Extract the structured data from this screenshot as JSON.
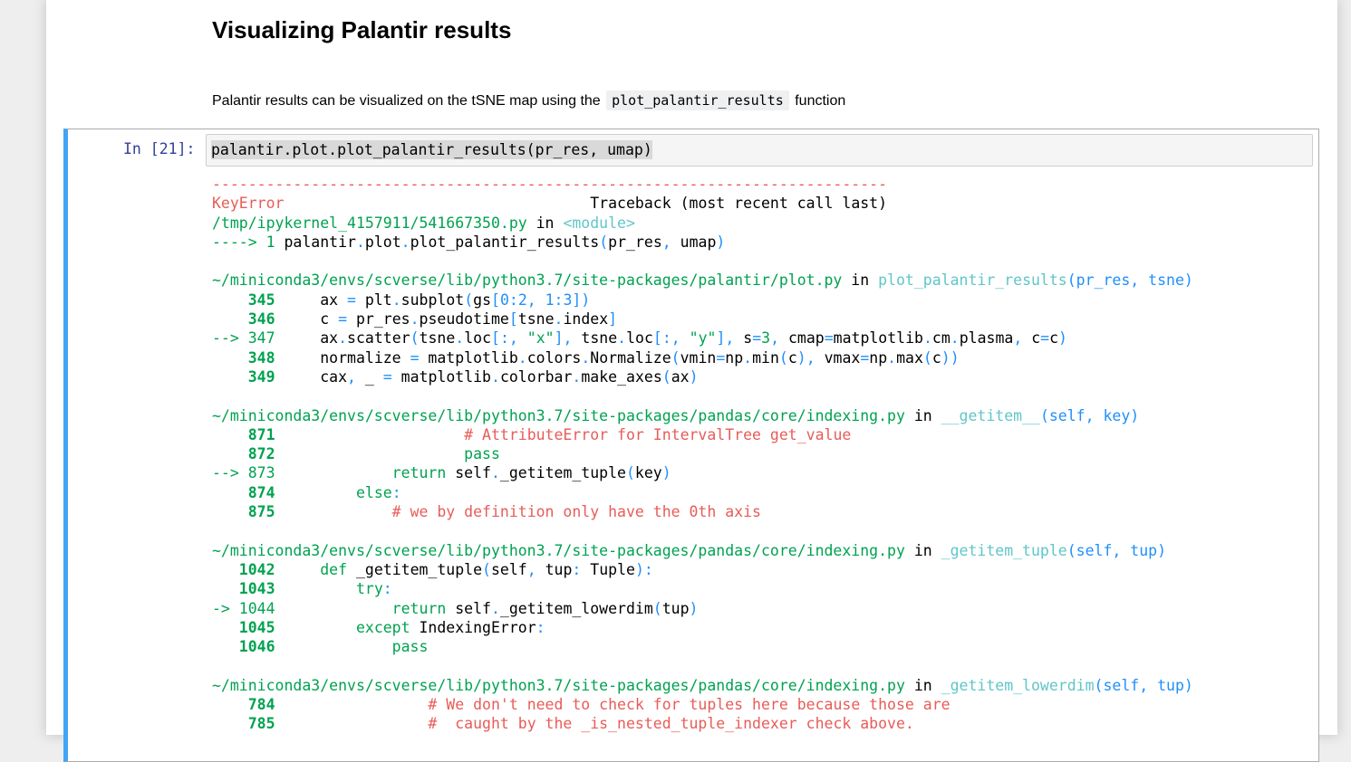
{
  "markdown": {
    "title": "Visualizing Palantir results",
    "para_before": "Palantir results can be visualized on the tSNE map using the ",
    "para_code": "plot_palantir_results",
    "para_after": " function"
  },
  "cell": {
    "prompt": "In [21]:",
    "input": "palantir.plot.plot_palantir_results(pr_res, umap)",
    "traceback": [
      [
        [
          "r",
          "---------------------------------------------------------------------------"
        ]
      ],
      [
        [
          "r",
          "KeyError"
        ],
        [
          "k",
          "                                  Traceback (most recent call last)"
        ]
      ],
      [
        [
          "g",
          "/tmp/ipykernel_4157911/541667350.py"
        ],
        [
          "k",
          " in "
        ],
        [
          "c",
          "<module>"
        ]
      ],
      [
        [
          "g",
          "----> 1 "
        ],
        [
          "k",
          "palantir"
        ],
        [
          "b",
          "."
        ],
        [
          "k",
          "plot"
        ],
        [
          "b",
          "."
        ],
        [
          "k",
          "plot_palantir_results"
        ],
        [
          "b",
          "("
        ],
        [
          "k",
          "pr_res"
        ],
        [
          "b",
          ", "
        ],
        [
          "k",
          "umap"
        ],
        [
          "b",
          ")"
        ]
      ],
      [],
      [
        [
          "g",
          "~/miniconda3/envs/scverse/lib/python3.7/site-packages/palantir/plot.py"
        ],
        [
          "k",
          " in "
        ],
        [
          "c",
          "plot_palantir_results"
        ],
        [
          "b",
          "(pr_res, tsne)"
        ]
      ],
      [
        [
          "gb",
          "    345"
        ],
        [
          "k",
          "     ax "
        ],
        [
          "b",
          "="
        ],
        [
          "k",
          " plt"
        ],
        [
          "b",
          "."
        ],
        [
          "k",
          "subplot"
        ],
        [
          "b",
          "("
        ],
        [
          "k",
          "gs"
        ],
        [
          "b",
          "[0:2, 1:3])"
        ]
      ],
      [
        [
          "gb",
          "    346"
        ],
        [
          "k",
          "     c "
        ],
        [
          "b",
          "="
        ],
        [
          "k",
          " pr_res"
        ],
        [
          "b",
          "."
        ],
        [
          "k",
          "pseudotime"
        ],
        [
          "b",
          "["
        ],
        [
          "k",
          "tsne"
        ],
        [
          "b",
          "."
        ],
        [
          "k",
          "index"
        ],
        [
          "b",
          "]"
        ]
      ],
      [
        [
          "g",
          "--> 347"
        ],
        [
          "k",
          "     ax"
        ],
        [
          "b",
          "."
        ],
        [
          "k",
          "scatter"
        ],
        [
          "b",
          "("
        ],
        [
          "k",
          "tsne"
        ],
        [
          "b",
          "."
        ],
        [
          "k",
          "loc"
        ],
        [
          "b",
          "[:, "
        ],
        [
          "g",
          "\"x\""
        ],
        [
          "b",
          "], "
        ],
        [
          "k",
          "tsne"
        ],
        [
          "b",
          "."
        ],
        [
          "k",
          "loc"
        ],
        [
          "b",
          "[:, "
        ],
        [
          "g",
          "\"y\""
        ],
        [
          "b",
          "], "
        ],
        [
          "k",
          "s"
        ],
        [
          "b",
          "="
        ],
        [
          "g",
          "3"
        ],
        [
          "b",
          ", "
        ],
        [
          "k",
          "cmap"
        ],
        [
          "b",
          "="
        ],
        [
          "k",
          "matplotlib"
        ],
        [
          "b",
          "."
        ],
        [
          "k",
          "cm"
        ],
        [
          "b",
          "."
        ],
        [
          "k",
          "plasma"
        ],
        [
          "b",
          ", "
        ],
        [
          "k",
          "c"
        ],
        [
          "b",
          "="
        ],
        [
          "k",
          "c"
        ],
        [
          "b",
          ")"
        ]
      ],
      [
        [
          "gb",
          "    348"
        ],
        [
          "k",
          "     normalize "
        ],
        [
          "b",
          "="
        ],
        [
          "k",
          " matplotlib"
        ],
        [
          "b",
          "."
        ],
        [
          "k",
          "colors"
        ],
        [
          "b",
          "."
        ],
        [
          "k",
          "Normalize"
        ],
        [
          "b",
          "("
        ],
        [
          "k",
          "vmin"
        ],
        [
          "b",
          "="
        ],
        [
          "k",
          "np"
        ],
        [
          "b",
          "."
        ],
        [
          "k",
          "min"
        ],
        [
          "b",
          "("
        ],
        [
          "k",
          "c"
        ],
        [
          "b",
          "), "
        ],
        [
          "k",
          "vmax"
        ],
        [
          "b",
          "="
        ],
        [
          "k",
          "np"
        ],
        [
          "b",
          "."
        ],
        [
          "k",
          "max"
        ],
        [
          "b",
          "("
        ],
        [
          "k",
          "c"
        ],
        [
          "b",
          "))"
        ]
      ],
      [
        [
          "gb",
          "    349"
        ],
        [
          "k",
          "     cax"
        ],
        [
          "b",
          ", "
        ],
        [
          "k",
          "_ "
        ],
        [
          "b",
          "="
        ],
        [
          "k",
          " matplotlib"
        ],
        [
          "b",
          "."
        ],
        [
          "k",
          "colorbar"
        ],
        [
          "b",
          "."
        ],
        [
          "k",
          "make_axes"
        ],
        [
          "b",
          "("
        ],
        [
          "k",
          "ax"
        ],
        [
          "b",
          ")"
        ]
      ],
      [],
      [
        [
          "g",
          "~/miniconda3/envs/scverse/lib/python3.7/site-packages/pandas/core/indexing.py"
        ],
        [
          "k",
          " in "
        ],
        [
          "c",
          "__getitem__"
        ],
        [
          "b",
          "(self, key)"
        ]
      ],
      [
        [
          "gb",
          "    871"
        ],
        [
          "r",
          "                     # AttributeError for IntervalTree get_value"
        ]
      ],
      [
        [
          "gb",
          "    872"
        ],
        [
          "g",
          "                     pass"
        ]
      ],
      [
        [
          "g",
          "--> 873"
        ],
        [
          "g",
          "             return"
        ],
        [
          "k",
          " self"
        ],
        [
          "b",
          "."
        ],
        [
          "k",
          "_getitem_tuple"
        ],
        [
          "b",
          "("
        ],
        [
          "k",
          "key"
        ],
        [
          "b",
          ")"
        ]
      ],
      [
        [
          "gb",
          "    874"
        ],
        [
          "g",
          "         else"
        ],
        [
          "b",
          ":"
        ]
      ],
      [
        [
          "gb",
          "    875"
        ],
        [
          "r",
          "             # we by definition only have the 0th axis"
        ]
      ],
      [],
      [
        [
          "g",
          "~/miniconda3/envs/scverse/lib/python3.7/site-packages/pandas/core/indexing.py"
        ],
        [
          "k",
          " in "
        ],
        [
          "c",
          "_getitem_tuple"
        ],
        [
          "b",
          "(self, tup)"
        ]
      ],
      [
        [
          "gb",
          "   1042"
        ],
        [
          "g",
          "     def"
        ],
        [
          "k",
          " _getitem_tuple"
        ],
        [
          "b",
          "("
        ],
        [
          "k",
          "self"
        ],
        [
          "b",
          ", "
        ],
        [
          "k",
          "tup"
        ],
        [
          "b",
          ": "
        ],
        [
          "k",
          "Tuple"
        ],
        [
          "b",
          "):"
        ]
      ],
      [
        [
          "gb",
          "   1043"
        ],
        [
          "g",
          "         try"
        ],
        [
          "b",
          ":"
        ]
      ],
      [
        [
          "g",
          "-> 1044"
        ],
        [
          "g",
          "             return"
        ],
        [
          "k",
          " self"
        ],
        [
          "b",
          "."
        ],
        [
          "k",
          "_getitem_lowerdim"
        ],
        [
          "b",
          "("
        ],
        [
          "k",
          "tup"
        ],
        [
          "b",
          ")"
        ]
      ],
      [
        [
          "gb",
          "   1045"
        ],
        [
          "g",
          "         except"
        ],
        [
          "k",
          " IndexingError"
        ],
        [
          "b",
          ":"
        ]
      ],
      [
        [
          "gb",
          "   1046"
        ],
        [
          "g",
          "             pass"
        ]
      ],
      [],
      [
        [
          "g",
          "~/miniconda3/envs/scverse/lib/python3.7/site-packages/pandas/core/indexing.py"
        ],
        [
          "k",
          " in "
        ],
        [
          "c",
          "_getitem_lowerdim"
        ],
        [
          "b",
          "(self, tup)"
        ]
      ],
      [
        [
          "gb",
          "    784"
        ],
        [
          "r",
          "                 # We don't need to check for tuples here because those are"
        ]
      ],
      [
        [
          "gb",
          "    785"
        ],
        [
          "r",
          "                 #  caught by the _is_nested_tuple_indexer check above."
        ]
      ]
    ]
  },
  "colors": {
    "cell_border_accent": "#42a5f5",
    "prompt": "#303f9f",
    "error_red": "#e75c58",
    "ansi_green": "#00a250",
    "ansi_cyan": "#60c6c8",
    "ansi_blue": "#208ffb"
  }
}
